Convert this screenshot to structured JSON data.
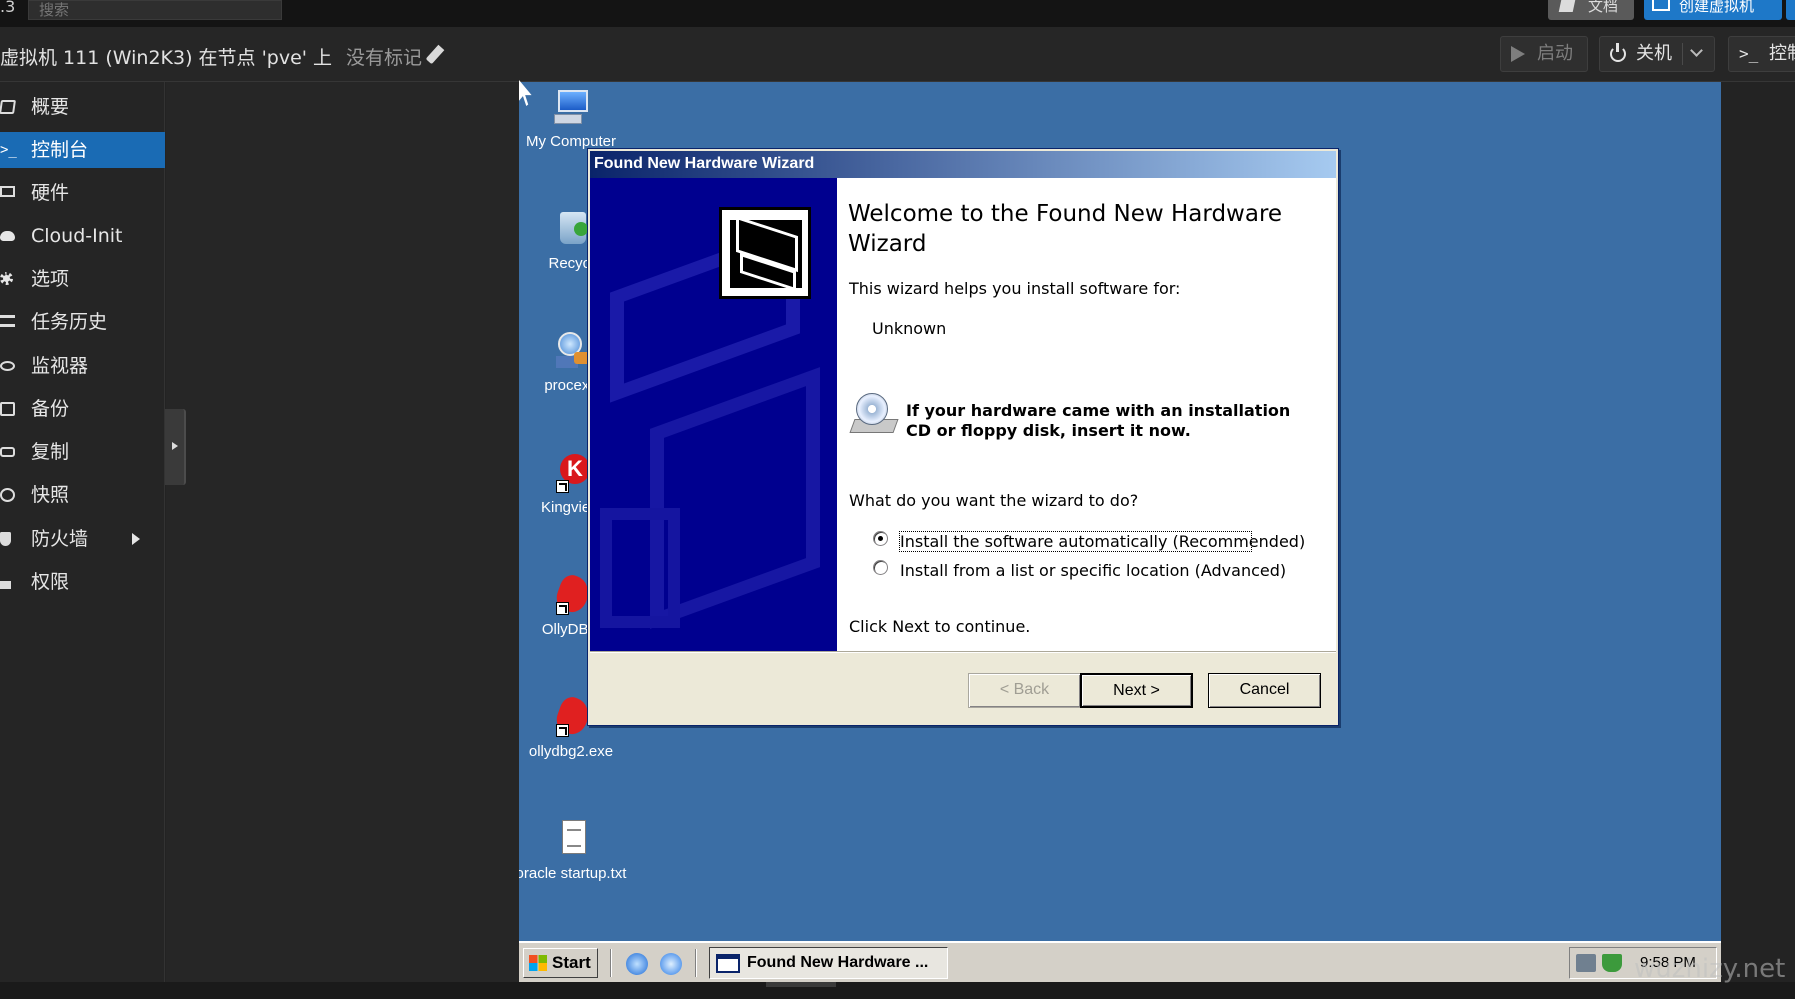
{
  "header": {
    "version": ".3",
    "search_placeholder": "搜索",
    "docs_label": "文档",
    "create_vm_label": "创建虚拟机"
  },
  "vm_bar": {
    "title": "虚拟机 111 (Win2K3) 在节点 'pve' 上",
    "tags": "没有标记",
    "start_label": "启动",
    "shutdown_label": "关机",
    "console_label": "控制"
  },
  "sidebar": {
    "items": [
      {
        "label": "概要",
        "icon": "book-icon"
      },
      {
        "label": "控制台",
        "icon": "terminal-icon"
      },
      {
        "label": "硬件",
        "icon": "monitor-icon"
      },
      {
        "label": "Cloud-Init",
        "icon": "cloud-icon"
      },
      {
        "label": "选项",
        "icon": "gear-icon"
      },
      {
        "label": "任务历史",
        "icon": "list-icon"
      },
      {
        "label": "监视器",
        "icon": "eye-icon"
      },
      {
        "label": "备份",
        "icon": "floppy-icon"
      },
      {
        "label": "复制",
        "icon": "retweet-icon"
      },
      {
        "label": "快照",
        "icon": "history-icon"
      },
      {
        "label": "防火墙",
        "icon": "shield-icon"
      },
      {
        "label": "权限",
        "icon": "unlock-icon"
      }
    ],
    "active_index": 1
  },
  "desktop": {
    "icons": [
      {
        "label": "My Computer"
      },
      {
        "label": "Recycl"
      },
      {
        "label": "procexp"
      },
      {
        "label": "Kingview"
      },
      {
        "label": "OllyDBG"
      },
      {
        "label": "ollydbg2.exe"
      },
      {
        "label": "oracle startup.txt"
      }
    ]
  },
  "wizard": {
    "title": "Found New Hardware Wizard",
    "heading": "Welcome to the Found New Hardware Wizard",
    "intro": "This wizard helps you install software for:",
    "device": "Unknown",
    "cd_notice": "If your hardware came with an installation CD or floppy disk, insert it now.",
    "question": "What do you want the wizard to do?",
    "options": [
      {
        "label": "Install the software automatically (Recommended)",
        "checked": true
      },
      {
        "label": "Install from a list or specific location (Advanced)",
        "checked": false
      }
    ],
    "continue_hint": "Click Next to continue.",
    "back_label": "< Back",
    "next_label": "Next >",
    "cancel_label": "Cancel"
  },
  "taskbar": {
    "start_label": "Start",
    "task_label": "Found New Hardware ...",
    "clock": "9:58 PM"
  },
  "watermark": "wuzhizy.net",
  "colors": {
    "accent": "#1a6bb4",
    "desktop": "#3b6ea5",
    "wizard_banner": "#00008f"
  }
}
